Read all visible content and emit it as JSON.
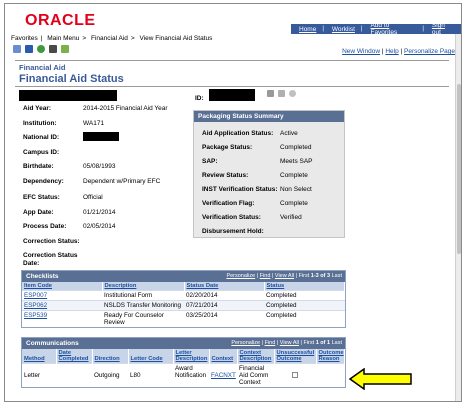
{
  "header": {
    "logo": "ORACLE",
    "links": [
      "Home",
      "Worklist",
      "Add to Favorites",
      "Sign out"
    ]
  },
  "breadcrumb": [
    "Favorites",
    "Main Menu",
    "Financial Aid",
    "View Financial Aid Status"
  ],
  "toolbar_icons": [
    "pencil-icon",
    "info-icon",
    "refresh-icon",
    "gear-icon",
    "notes-icon"
  ],
  "right_links": {
    "new_window": "New Window",
    "help": "Help",
    "personalize": "Personalize Page"
  },
  "page": {
    "section_label": "Financial Aid",
    "title": "Financial Aid Status",
    "id_label": "ID:"
  },
  "fields": [
    {
      "label": "Aid Year:",
      "value": "2014-2015 Financial Aid Year"
    },
    {
      "label": "Institution:",
      "value": "WA171"
    },
    {
      "label": "National ID:",
      "value": ""
    },
    {
      "label": "Campus ID:",
      "value": ""
    },
    {
      "label": "Birthdate:",
      "value": "05/08/1993"
    },
    {
      "label": "Dependency:",
      "value": "Dependent w/Primary EFC"
    },
    {
      "label": "EFC Status:",
      "value": "Official"
    },
    {
      "label": "App Date:",
      "value": "01/21/2014"
    },
    {
      "label": "Process Date:",
      "value": "02/05/2014"
    },
    {
      "label": "Correction Status:",
      "value": ""
    },
    {
      "label": "Correction Status Date:",
      "value": ""
    }
  ],
  "packaging": {
    "title": "Packaging Status Summary",
    "rows": [
      {
        "label": "Aid Application Status:",
        "value": "Active"
      },
      {
        "label": "Package Status:",
        "value": "Completed"
      },
      {
        "label": "SAP:",
        "value": "Meets SAP"
      },
      {
        "label": "Review Status:",
        "value": "Complete"
      },
      {
        "label": "INST Verification Status:",
        "value": "Non Select"
      },
      {
        "label": "Verification Flag:",
        "value": "Complete"
      },
      {
        "label": "Verification Status:",
        "value": "Verified"
      },
      {
        "label": "Disbursement Hold:",
        "value": ""
      }
    ]
  },
  "checklists": {
    "title": "Checklists",
    "nav": {
      "personalize": "Personalize",
      "find": "Find",
      "view_all": "View All",
      "first": "First",
      "range": "1-3 of 3",
      "last": "Last"
    },
    "columns": [
      "Item Code",
      "Description",
      "Status Date",
      "Status"
    ],
    "rows": [
      [
        "ESP007",
        "Institutional Form",
        "02/20/2014",
        "Completed"
      ],
      [
        "ESP062",
        "NSLDS Transfer Monitoring",
        "07/21/2014",
        "Completed"
      ],
      [
        "ESP539",
        "Ready For Counselor Review",
        "03/25/2014",
        "Completed"
      ]
    ]
  },
  "communications": {
    "title": "Communications",
    "nav": {
      "personalize": "Personalize",
      "find": "Find",
      "view_all": "View All",
      "first": "First",
      "range": "1 of 1",
      "last": "Last"
    },
    "columns": [
      "Method",
      "Date Completed",
      "Direction",
      "Letter Code",
      "Letter Description",
      "Context",
      "Context Description",
      "Unsuccessful Outcome",
      "Outcome Reason"
    ],
    "rows": [
      [
        "Letter",
        "",
        "Outgoing",
        "L80",
        "Award Notification",
        "FACNXT",
        "Financial Aid Comm Context",
        "",
        ""
      ]
    ]
  },
  "colors": {
    "oracle_red": "#e3001b",
    "header_blue": "#375a9a",
    "grid_header": "#5a6f94",
    "arrow_yellow": "#ffff00"
  }
}
